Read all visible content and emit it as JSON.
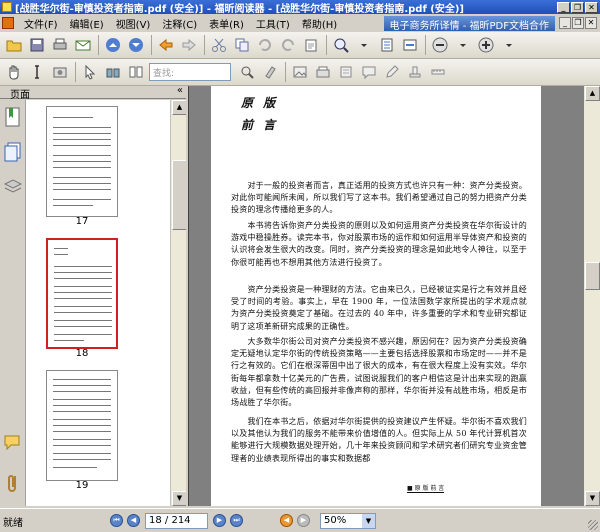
{
  "window": {
    "title": "[战胜华尔街-审慎投资者指南.pdf (安全)] - 福昕阅读器 - [战胜华尔街-审慎投资者指南.pdf (安全)]",
    "minimize_label": "_",
    "restore_label": "❐",
    "close_label": "✕"
  },
  "menu": {
    "items": [
      "文件(F)",
      "编辑(E)",
      "视图(V)",
      "注释(C)",
      "表单(R)",
      "工具(T)",
      "帮助(H)"
    ],
    "promo": "电子商务所译情 - 福昕PDF文档合作",
    "mdi_min": "_",
    "mdi_restore": "❐",
    "mdi_close": "✕"
  },
  "toolbar": {
    "search_placeholder": "查找:"
  },
  "panel": {
    "title": "页面",
    "collapse": "«"
  },
  "thumbnails": [
    {
      "label": "17",
      "selected": false
    },
    {
      "label": "18",
      "selected": true
    },
    {
      "label": "19",
      "selected": false
    }
  ],
  "document": {
    "heading1": "原 版",
    "heading2": "前 言",
    "paragraphs": [
      "　　对于一般的投资者而言，真正适用的投资方式也许只有一种：资产分类投资。对此你可能闻所未闻，所以我们写了这本书。我们希望通过自己的努力把资产分类投资的理念传播给更多的人。",
      "　　本书将告诉你资产分类投资的原则以及如何运用资产分类投资在华尔街设计的游戏中稳操胜券。读完本书，你对股票市场的运作和如何运用半导体资产和投资的认识将会发生很大的改变。同时，资产分类投资的理念是如此地令人神往，以至于你很可能再也不想用其他方法进行投资了。",
      "　　资产分类投资是一种理财的方法。它由来已久，已经被证实是行之有效并且经受了时间的考验。事实上，早在 1900 年，一位法国数学家所提出的学术观点就为资产分类投资奠定了基础。在过去的 40 年中，许多重要的学术和专业研究都证明了这项革新研究成果的正确性。",
      "　　大多数华尔街公司对资产分类投资不感兴趣，原因何在？因为资产分类投资确定无疑地认定华尔街的传统投资策略——主要包括选择股票和市场定时——并不是行之有效的。它们在根深蒂固中出了很大的成本，有在很大程度上没有实效。华尔街每年都拿数十亿美元的广告费，试图说服我们的客户相信这是计出来实现的跑赢收益，但有些传统的高回报并非像声称的那样，华尔街并没有战胜市场，相反是市场战胜了华尔街。",
      "　　我们在本书之后，依据对华尔街提供的投资建议产生怀疑。华尔街不喜欢我们以及其他认为我们的服务不能带来价值增值的人。但实际上从 50 年代计算机首次能够进行大规模数据处理开始，几十年来投资顾问和学术研究者们研究专业资金管理者的业绩表现所得出的事实和数据都"
    ],
    "footer": "■ 原 版 前 言"
  },
  "status": {
    "text": "就绪",
    "first": "⏮",
    "prev": "◀",
    "page_display": "18 / 214",
    "next": "▶",
    "last": "⏭",
    "back": "◀",
    "forward": "▶",
    "zoom": "50%",
    "zoom_arrow": "▼"
  }
}
